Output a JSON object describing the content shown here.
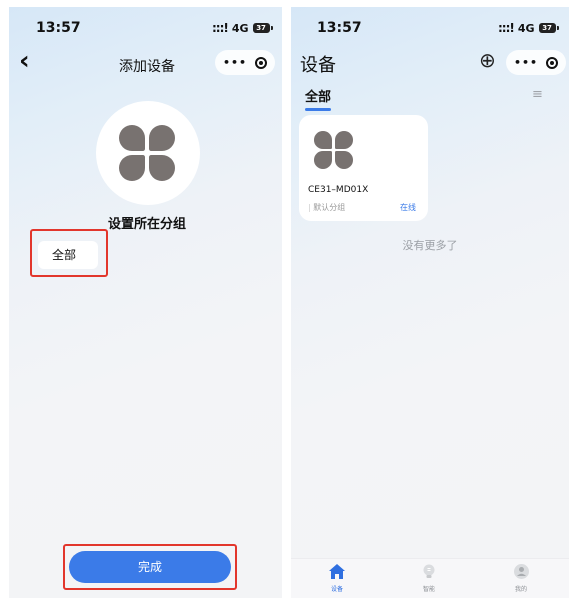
{
  "left_screen": {
    "status_bar": {
      "time": "13:57",
      "signal": "4G",
      "battery": "37"
    },
    "nav": {
      "back_icon": "‹",
      "title": "添加设备",
      "more_icon": "•••"
    },
    "section_title": "设置所在分组",
    "group_chip": "全部",
    "done_button": "完成"
  },
  "right_screen": {
    "status_bar": {
      "time": "13:57",
      "signal": "4G",
      "battery": "37"
    },
    "title": "设备",
    "add_icon": "⊕",
    "tab_all": "全部",
    "menu_icon": "≡",
    "device": {
      "name": "CE31–MD01X",
      "group": "默认分组",
      "status": "在线"
    },
    "no_more": "没有更多了",
    "bottom_nav": [
      {
        "label": "设备",
        "icon": "home-icon"
      },
      {
        "label": "智能",
        "icon": "bulb-icon"
      },
      {
        "label": "我的",
        "icon": "user-icon"
      }
    ]
  },
  "colors": {
    "accent": "#3b7be8",
    "highlight_box": "#e2362c",
    "device_logo": "#787270"
  }
}
